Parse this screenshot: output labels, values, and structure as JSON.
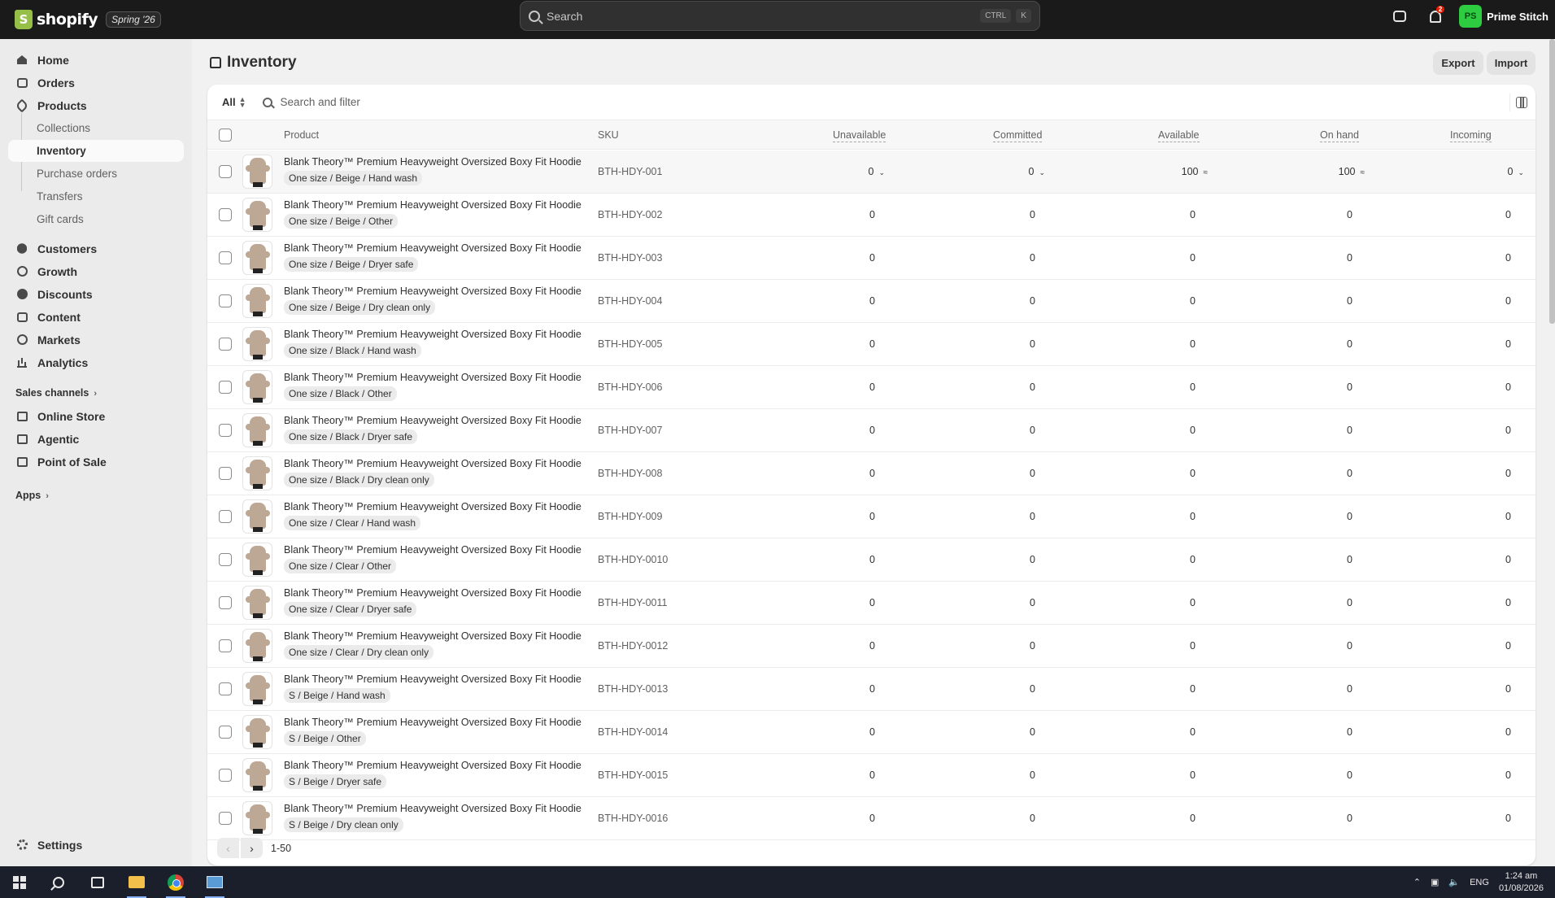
{
  "topbar": {
    "logo_text": "shopify",
    "edition": "Spring '26",
    "search_placeholder": "Search",
    "kbd_ctrl": "CTRL",
    "kbd_k": "K",
    "notification_count": "2",
    "store_initials": "PS",
    "store_name": "Prime Stitch"
  },
  "sidebar": {
    "items": [
      {
        "label": "Home"
      },
      {
        "label": "Orders"
      },
      {
        "label": "Products"
      },
      {
        "label": "Collections"
      },
      {
        "label": "Inventory"
      },
      {
        "label": "Purchase orders"
      },
      {
        "label": "Transfers"
      },
      {
        "label": "Gift cards"
      },
      {
        "label": "Customers"
      },
      {
        "label": "Growth"
      },
      {
        "label": "Discounts"
      },
      {
        "label": "Content"
      },
      {
        "label": "Markets"
      },
      {
        "label": "Analytics"
      }
    ],
    "sales_channels_label": "Sales channels",
    "channels": [
      {
        "label": "Online Store"
      },
      {
        "label": "Agentic"
      },
      {
        "label": "Point of Sale"
      }
    ],
    "apps_label": "Apps",
    "settings_label": "Settings"
  },
  "page": {
    "title": "Inventory",
    "export_label": "Export",
    "import_label": "Import",
    "filter_all": "All",
    "filter_placeholder": "Search and filter"
  },
  "table": {
    "headers": {
      "product": "Product",
      "sku": "SKU",
      "unavailable": "Unavailable",
      "committed": "Committed",
      "available": "Available",
      "on_hand": "On hand",
      "incoming": "Incoming"
    },
    "rows": [
      {
        "name": "Blank Theory™ Premium Heavyweight Oversized Boxy Fit Hoodie",
        "variant": "One size / Beige / Hand wash",
        "sku": "BTH-HDY-001",
        "unavailable": "0",
        "committed": "0",
        "available": "100",
        "on_hand": "100",
        "incoming": "0"
      },
      {
        "name": "Blank Theory™ Premium Heavyweight Oversized Boxy Fit Hoodie",
        "variant": "One size / Beige / Other",
        "sku": "BTH-HDY-002",
        "unavailable": "0",
        "committed": "0",
        "available": "0",
        "on_hand": "0",
        "incoming": "0"
      },
      {
        "name": "Blank Theory™ Premium Heavyweight Oversized Boxy Fit Hoodie",
        "variant": "One size / Beige / Dryer safe",
        "sku": "BTH-HDY-003",
        "unavailable": "0",
        "committed": "0",
        "available": "0",
        "on_hand": "0",
        "incoming": "0"
      },
      {
        "name": "Blank Theory™ Premium Heavyweight Oversized Boxy Fit Hoodie",
        "variant": "One size / Beige / Dry clean only",
        "sku": "BTH-HDY-004",
        "unavailable": "0",
        "committed": "0",
        "available": "0",
        "on_hand": "0",
        "incoming": "0"
      },
      {
        "name": "Blank Theory™ Premium Heavyweight Oversized Boxy Fit Hoodie",
        "variant": "One size / Black / Hand wash",
        "sku": "BTH-HDY-005",
        "unavailable": "0",
        "committed": "0",
        "available": "0",
        "on_hand": "0",
        "incoming": "0"
      },
      {
        "name": "Blank Theory™ Premium Heavyweight Oversized Boxy Fit Hoodie",
        "variant": "One size / Black / Other",
        "sku": "BTH-HDY-006",
        "unavailable": "0",
        "committed": "0",
        "available": "0",
        "on_hand": "0",
        "incoming": "0"
      },
      {
        "name": "Blank Theory™ Premium Heavyweight Oversized Boxy Fit Hoodie",
        "variant": "One size / Black / Dryer safe",
        "sku": "BTH-HDY-007",
        "unavailable": "0",
        "committed": "0",
        "available": "0",
        "on_hand": "0",
        "incoming": "0"
      },
      {
        "name": "Blank Theory™ Premium Heavyweight Oversized Boxy Fit Hoodie",
        "variant": "One size / Black / Dry clean only",
        "sku": "BTH-HDY-008",
        "unavailable": "0",
        "committed": "0",
        "available": "0",
        "on_hand": "0",
        "incoming": "0"
      },
      {
        "name": "Blank Theory™ Premium Heavyweight Oversized Boxy Fit Hoodie",
        "variant": "One size / Clear / Hand wash",
        "sku": "BTH-HDY-009",
        "unavailable": "0",
        "committed": "0",
        "available": "0",
        "on_hand": "0",
        "incoming": "0"
      },
      {
        "name": "Blank Theory™ Premium Heavyweight Oversized Boxy Fit Hoodie",
        "variant": "One size / Clear / Other",
        "sku": "BTH-HDY-0010",
        "unavailable": "0",
        "committed": "0",
        "available": "0",
        "on_hand": "0",
        "incoming": "0"
      },
      {
        "name": "Blank Theory™ Premium Heavyweight Oversized Boxy Fit Hoodie",
        "variant": "One size / Clear / Dryer safe",
        "sku": "BTH-HDY-0011",
        "unavailable": "0",
        "committed": "0",
        "available": "0",
        "on_hand": "0",
        "incoming": "0"
      },
      {
        "name": "Blank Theory™ Premium Heavyweight Oversized Boxy Fit Hoodie",
        "variant": "One size / Clear / Dry clean only",
        "sku": "BTH-HDY-0012",
        "unavailable": "0",
        "committed": "0",
        "available": "0",
        "on_hand": "0",
        "incoming": "0"
      },
      {
        "name": "Blank Theory™ Premium Heavyweight Oversized Boxy Fit Hoodie",
        "variant": "S / Beige / Hand wash",
        "sku": "BTH-HDY-0013",
        "unavailable": "0",
        "committed": "0",
        "available": "0",
        "on_hand": "0",
        "incoming": "0"
      },
      {
        "name": "Blank Theory™ Premium Heavyweight Oversized Boxy Fit Hoodie",
        "variant": "S / Beige / Other",
        "sku": "BTH-HDY-0014",
        "unavailable": "0",
        "committed": "0",
        "available": "0",
        "on_hand": "0",
        "incoming": "0"
      },
      {
        "name": "Blank Theory™ Premium Heavyweight Oversized Boxy Fit Hoodie",
        "variant": "S / Beige / Dryer safe",
        "sku": "BTH-HDY-0015",
        "unavailable": "0",
        "committed": "0",
        "available": "0",
        "on_hand": "0",
        "incoming": "0"
      },
      {
        "name": "Blank Theory™ Premium Heavyweight Oversized Boxy Fit Hoodie",
        "variant": "S / Beige / Dry clean only",
        "sku": "BTH-HDY-0016",
        "unavailable": "0",
        "committed": "0",
        "available": "0",
        "on_hand": "0",
        "incoming": "0"
      }
    ]
  },
  "pagination": {
    "range": "1-50"
  },
  "taskbar": {
    "language": "ENG",
    "time": "1:24 am",
    "date": "01/08/2026"
  },
  "colors": {
    "topbar_bg": "#1a1a1a",
    "brand_green": "#95bf47",
    "taskbar_bg": "#1b1f2b"
  }
}
